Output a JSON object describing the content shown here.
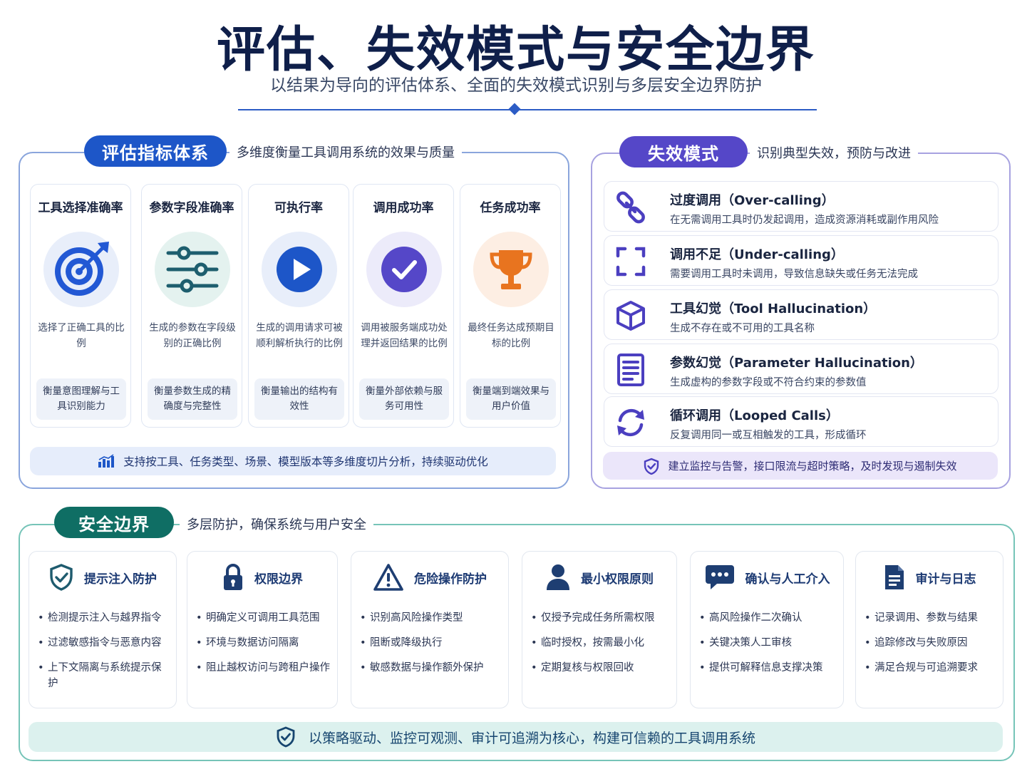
{
  "header": {
    "title": "评估、失效模式与安全边界",
    "subtitle": "以结果为导向的评估体系、全面的失效模式识别与多层安全边界防护"
  },
  "evaluation": {
    "label": "评估指标体系",
    "description": "多维度衡量工具调用系统的效果与质量",
    "metrics": [
      {
        "title": "工具选择准确率",
        "desc": "选择了正确工具的比例",
        "measure": "衡量意图理解与工具识别能力",
        "icon": "target-icon"
      },
      {
        "title": "参数字段准确率",
        "desc": "生成的参数在字段级别的正确比例",
        "measure": "衡量参数生成的精确度与完整性",
        "icon": "sliders-icon"
      },
      {
        "title": "可执行率",
        "desc": "生成的调用请求可被顺利解析执行的比例",
        "measure": "衡量输出的结构有效性",
        "icon": "play-icon"
      },
      {
        "title": "调用成功率",
        "desc": "调用被服务端成功处理并返回结果的比例",
        "measure": "衡量外部依赖与服务可用性",
        "icon": "check-icon"
      },
      {
        "title": "任务成功率",
        "desc": "最终任务达成预期目标的比例",
        "measure": "衡量端到端效果与用户价值",
        "icon": "trophy-icon"
      }
    ],
    "footer": "支持按工具、任务类型、场景、模型版本等多维度切片分析，持续驱动优化"
  },
  "failure": {
    "label": "失效模式",
    "description": "识别典型失效，预防与改进",
    "items": [
      {
        "title": "过度调用（Over-calling）",
        "desc": "在无需调用工具时仍发起调用，造成资源消耗或副作用风险",
        "icon": "link-icon"
      },
      {
        "title": "调用不足（Under-calling）",
        "desc": "需要调用工具时未调用，导致信息缺失或任务无法完成",
        "icon": "frame-icon"
      },
      {
        "title": "工具幻觉（Tool Hallucination）",
        "desc": "生成不存在或不可用的工具名称",
        "icon": "cube-icon"
      },
      {
        "title": "参数幻觉（Parameter Hallucination）",
        "desc": "生成虚构的参数字段或不符合约束的参数值",
        "icon": "document-icon"
      },
      {
        "title": "循环调用（Looped Calls）",
        "desc": "反复调用同一或互相触发的工具，形成循环",
        "icon": "loop-icon"
      }
    ],
    "footer": "建立监控与告警，接口限流与超时策略，及时发现与遏制失效"
  },
  "safety": {
    "label": "安全边界",
    "description": "多层防护，确保系统与用户安全",
    "cards": [
      {
        "title": "提示注入防护",
        "icon": "shield-check-icon",
        "items": [
          "检测提示注入与越界指令",
          "过滤敏感指令与恶意内容",
          "上下文隔离与系统提示保护"
        ]
      },
      {
        "title": "权限边界",
        "icon": "lock-icon",
        "items": [
          "明确定义可调用工具范围",
          "环境与数据访问隔离",
          "阻止越权访问与跨租户操作"
        ]
      },
      {
        "title": "危险操作防护",
        "icon": "warning-icon",
        "items": [
          "识别高风险操作类型",
          "阻断或降级执行",
          "敏感数据与操作额外保护"
        ]
      },
      {
        "title": "最小权限原则",
        "icon": "user-icon",
        "items": [
          "仅授予完成任务所需权限",
          "临时授权，按需最小化",
          "定期复核与权限回收"
        ]
      },
      {
        "title": "确认与人工介入",
        "icon": "chat-icon",
        "items": [
          "高风险操作二次确认",
          "关键决策人工审核",
          "提供可解释信息支撑决策"
        ]
      },
      {
        "title": "审计与日志",
        "icon": "log-icon",
        "items": [
          "记录调用、参数与结果",
          "追踪修改与失败原因",
          "满足合规与可追溯要求"
        ]
      }
    ],
    "footer": "以策略驱动、监控可观测、审计可追溯为核心，构建可信赖的工具调用系统"
  }
}
